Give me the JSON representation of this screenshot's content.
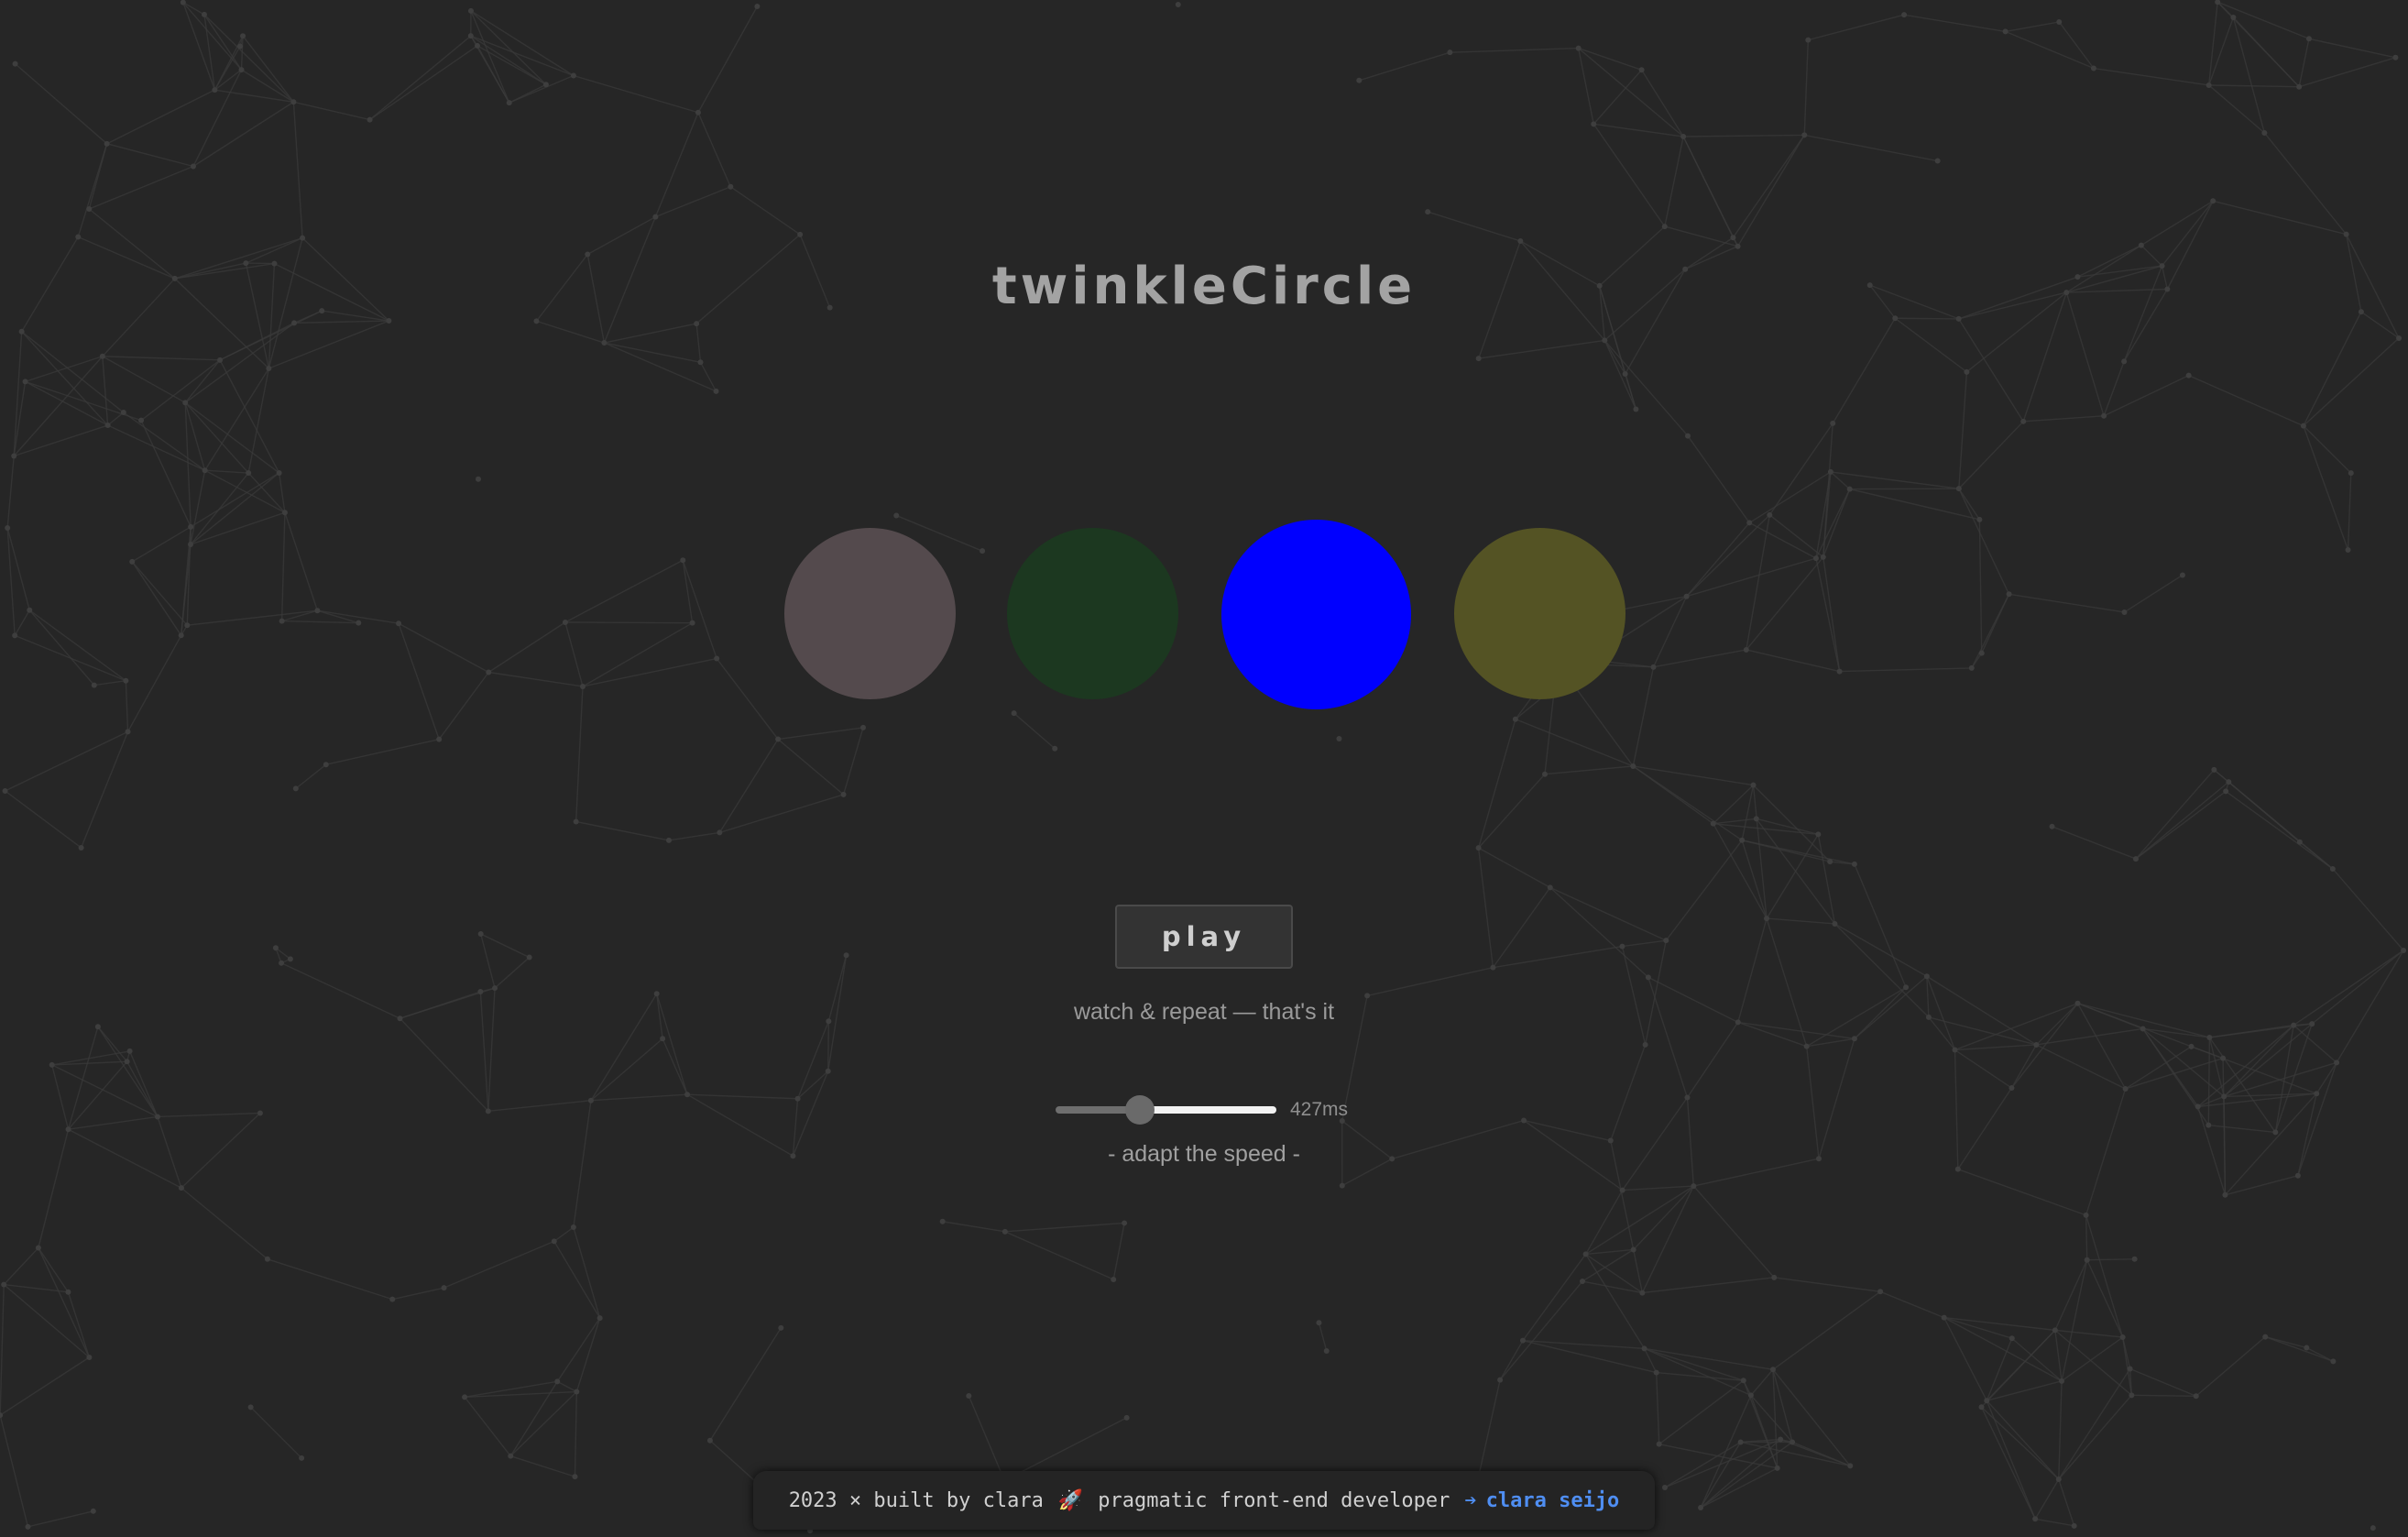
{
  "app": {
    "title": "twinkleCircle"
  },
  "circles": [
    {
      "color": "#544a4d",
      "state": "dim"
    },
    {
      "color": "#1c3820",
      "state": "dim"
    },
    {
      "color": "#0000ff",
      "state": "lit"
    },
    {
      "color": "#545324",
      "state": "dim"
    }
  ],
  "controls": {
    "play_label": "play",
    "hint": "watch & repeat — that's it",
    "speed": {
      "value_label": "427ms",
      "fill_fraction": 0.28,
      "caption": "- adapt the speed -"
    }
  },
  "footer": {
    "credit": "2023 × built by clara",
    "rocket_icon": "🚀",
    "role": "pragmatic front-end developer",
    "arrow": "➔",
    "link_label": "clara seijo",
    "link_color": "#4f8ef2"
  },
  "colors": {
    "background": "#262626",
    "network_lines": "#3a3a3a"
  }
}
